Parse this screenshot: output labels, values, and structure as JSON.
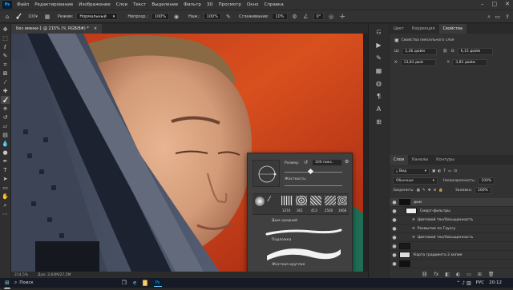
{
  "menubar": {
    "app_badge": "Ps",
    "items": [
      "Файл",
      "Редактирование",
      "Изображение",
      "Слои",
      "Текст",
      "Выделение",
      "Фильтр",
      "3D",
      "Просмотр",
      "Окно",
      "Справка"
    ],
    "window_controls": [
      "–",
      "□",
      "✕"
    ]
  },
  "options": {
    "brush_size": "100",
    "mode_label": "Режим:",
    "mode_value": "Нормальный",
    "opacity_label": "Непрозр.:",
    "opacity_value": "100%",
    "flow_label": "Наж.:",
    "flow_value": "100%",
    "smoothing_label": "Сглаживание:",
    "smoothing_value": "10%",
    "angle_value": "0°"
  },
  "document_tab": {
    "title": "Без имени-1 @ 215% (Ч, RGB/8#) *",
    "close": "×"
  },
  "status": {
    "zoom": "214,5%",
    "doc": "Док: 2,64M/27,5M"
  },
  "properties": {
    "tabs": [
      "Цвет",
      "Коррекция",
      "Свойства"
    ],
    "active_tab": 2,
    "subtitle": "Свойства пиксельного слоя",
    "w_label": "Ш:",
    "w_value": "1,36 дюйм",
    "h_label": "В:",
    "h_value": "6,15 дюйм",
    "x_label": "X:",
    "x_value": "13,83 дюй",
    "y_label": "Y:",
    "y_value": "3,85 дюйм"
  },
  "layers": {
    "tabs": [
      "Слои",
      "Каналы",
      "Контуры"
    ],
    "active_tab": 0,
    "search_value": "Вид",
    "blend_value": "Обычные",
    "opacity_label": "Непрозрачность:",
    "opacity_value": "100%",
    "lock_label": "Закрепить:",
    "fill_label": "Заливка:",
    "fill_value": "100%",
    "items": [
      {
        "name": "дым",
        "indent": 0,
        "thumb": "#101010",
        "eye": "●"
      },
      {
        "name": "Смарт-фильтры",
        "indent": 1,
        "thumb": "#eeeeee",
        "eye": "●"
      },
      {
        "name": "Цветовой тон/Насыщенность",
        "indent": 2,
        "thumb": "",
        "eye": "●"
      },
      {
        "name": "Размытие по Гауссу",
        "indent": 2,
        "thumb": "",
        "eye": "●"
      },
      {
        "name": "Цветовой тон/Насыщенность",
        "indent": 2,
        "thumb": "",
        "eye": "●"
      },
      {
        "name": "",
        "indent": 0,
        "thumb": "#1a1a1a",
        "eye": "●"
      },
      {
        "name": "Карта градиента 2 копия",
        "indent": 0,
        "thumb": "#dddddd",
        "eye": "●"
      },
      {
        "name": "",
        "indent": 0,
        "thumb": "#111111",
        "eye": "●"
      }
    ]
  },
  "brush_popup": {
    "size_label": "Размер:",
    "size_value": "100 пикс.",
    "hardness_label": "Жесткость:",
    "presets": [
      "1374",
      "361",
      "413",
      "2500",
      "1668"
    ],
    "groups": [
      "Дым средний",
      "Подложка",
      "Жесткая круглая"
    ]
  },
  "taskbar": {
    "search_label": "Поиск",
    "lang": "РУС",
    "time": "20:12"
  },
  "icons": {
    "brush": "brush-icon",
    "search": "search-icon",
    "eye": "eye-icon"
  }
}
